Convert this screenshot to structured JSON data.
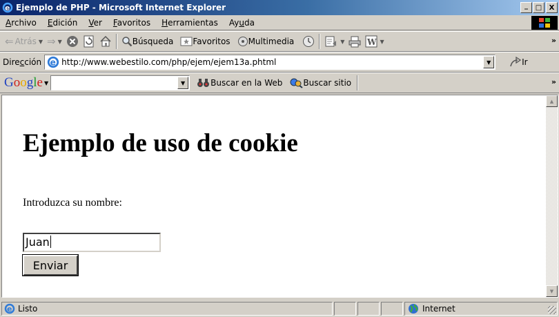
{
  "window": {
    "title": "Ejemplo de PHP - Microsoft Internet Explorer",
    "icon": "ie-icon",
    "controls": {
      "minimize": "_",
      "maximize": "□",
      "close": "X"
    }
  },
  "menu": {
    "items": [
      {
        "label": "Archivo",
        "accel": "A",
        "rest": "rchivo"
      },
      {
        "label": "Edición",
        "accel": "E",
        "rest": "dición"
      },
      {
        "label": "Ver",
        "accel": "V",
        "rest": "er"
      },
      {
        "label": "Favoritos",
        "accel": "F",
        "rest": "avoritos"
      },
      {
        "label": "Herramientas",
        "accel": "H",
        "rest": "erramientas"
      },
      {
        "label": "Ayuda",
        "pre": "Ay",
        "accel": "u",
        "rest": "da"
      }
    ]
  },
  "toolbar": {
    "back_label": "Atrás",
    "search_label": "Búsqueda",
    "favorites_label": "Favoritos",
    "media_label": "Multimedia",
    "more": "»"
  },
  "address": {
    "label_pre": "Dire",
    "label_accel": "c",
    "label_post": "ción",
    "url": "http://www.webestilo.com/php/ejem/ejem13a.phtml",
    "go_label": "Ir"
  },
  "google_toolbar": {
    "logo": "Google",
    "search_value": "",
    "web_search_label": "Buscar en la Web",
    "site_search_label": "Buscar sitio",
    "more": "»"
  },
  "page": {
    "heading": "Ejemplo de uso de cookie",
    "prompt": "Introduzca su nombre:",
    "name_value": "Juan",
    "submit_label": "Enviar"
  },
  "status": {
    "text": "Listo",
    "zone": "Internet"
  },
  "colors": {
    "titlebar_start": "#0a246a",
    "titlebar_end": "#a6caf0",
    "chrome": "#d4d0c8"
  }
}
